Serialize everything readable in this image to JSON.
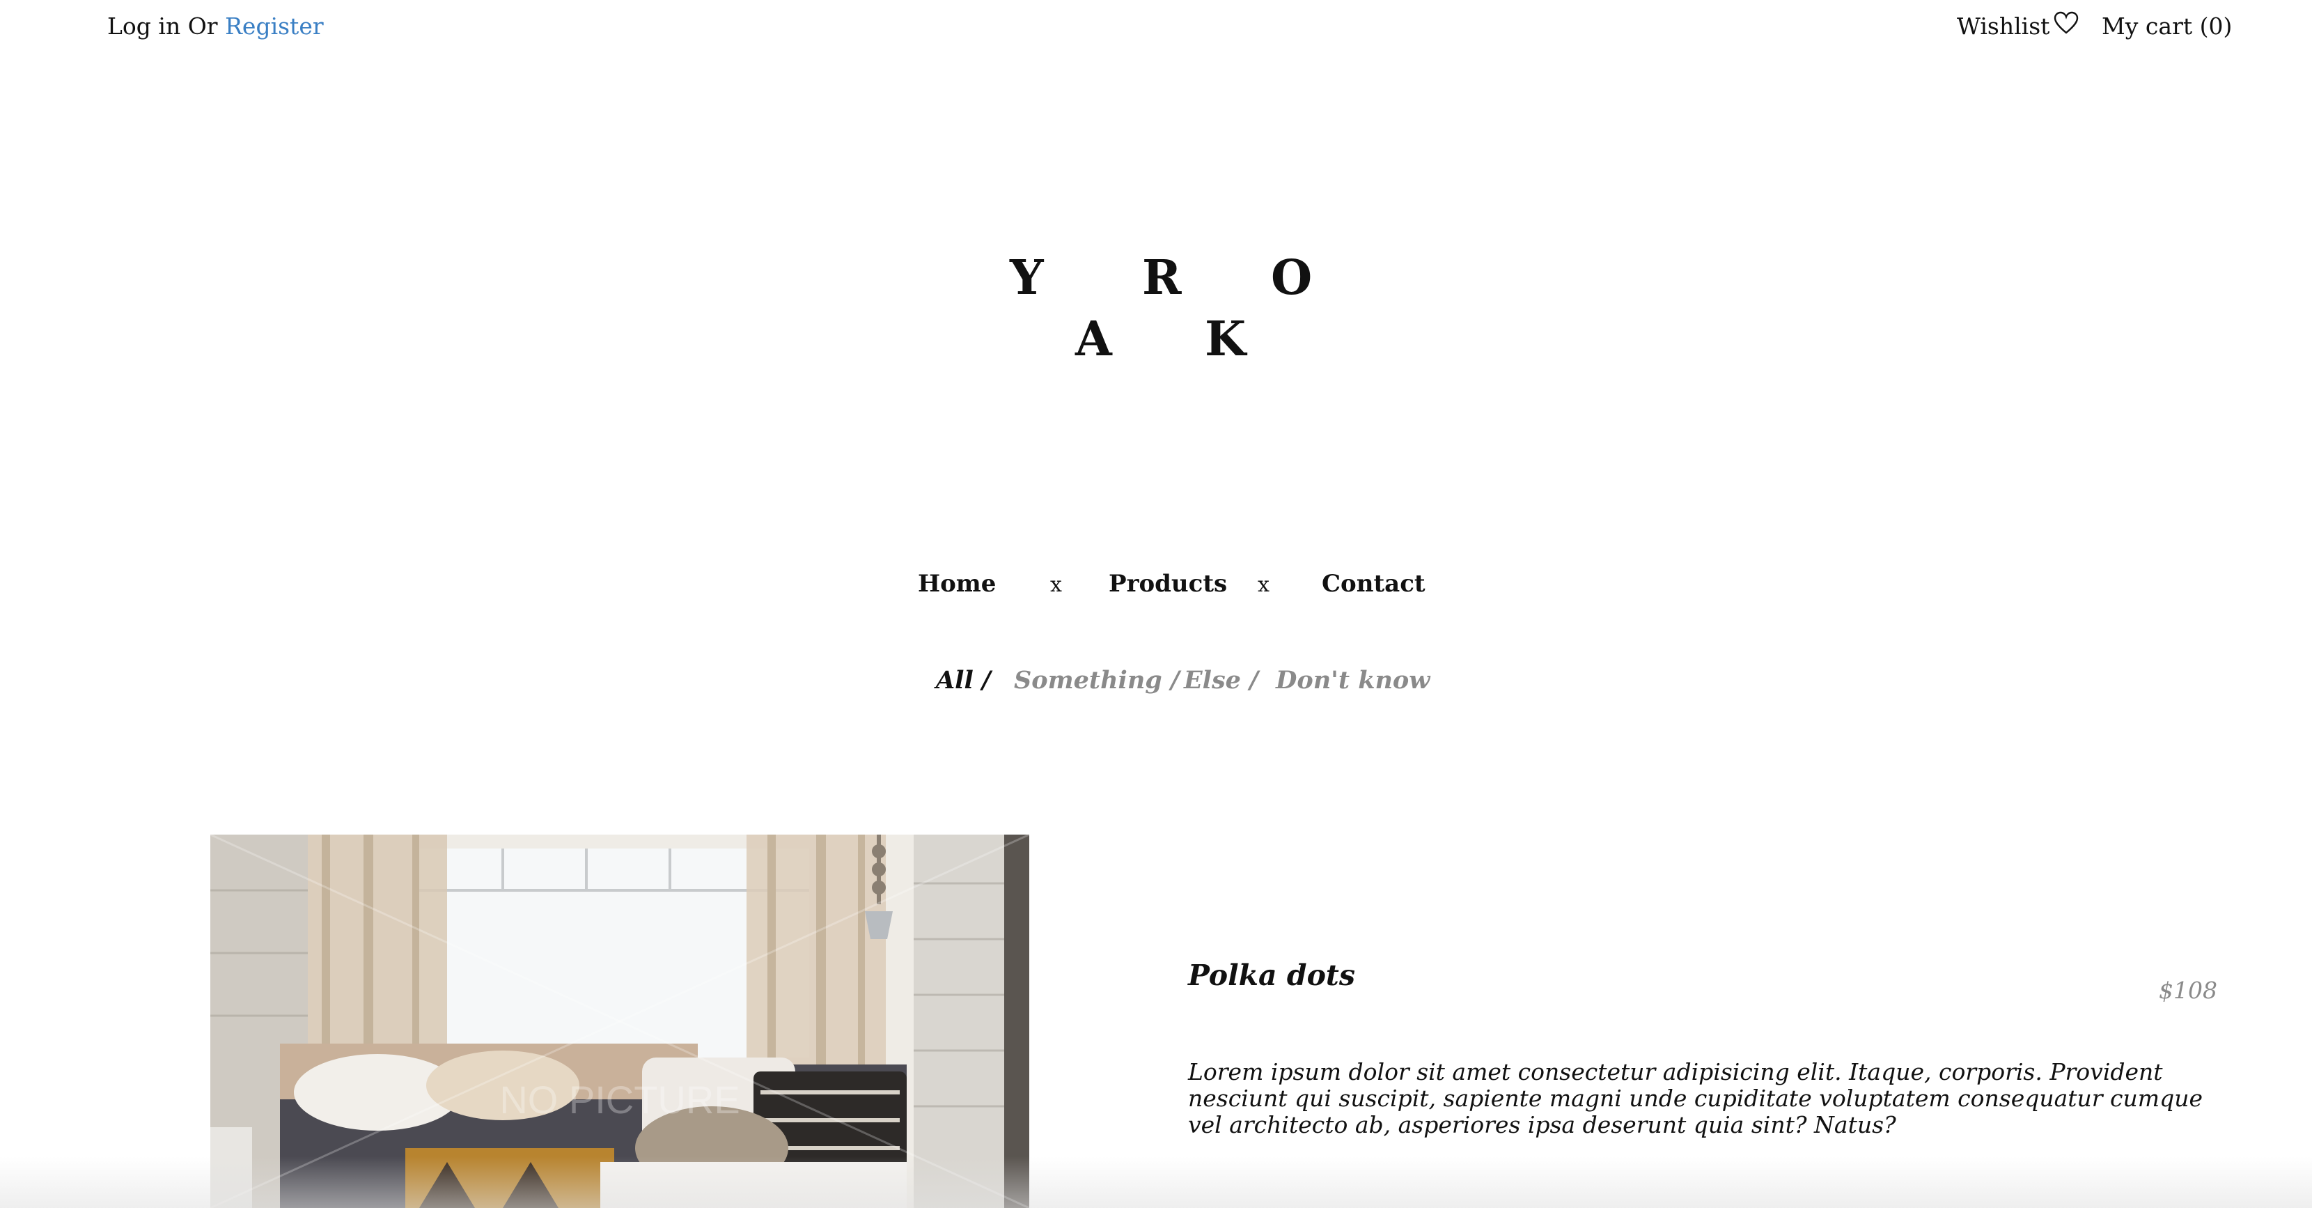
{
  "header": {
    "login_label": "Log in",
    "or_label": "Or",
    "register_label": "Register",
    "wishlist_label": "Wishlist",
    "cart_label": "My cart (0)"
  },
  "logo": {
    "letters": [
      "Y",
      "R",
      "O",
      "A",
      "K"
    ]
  },
  "main_nav": {
    "items": [
      "Home",
      "Products",
      "Contact"
    ],
    "separator": "x"
  },
  "filters": {
    "items": [
      "All /",
      "Something /",
      "Else /",
      "Don't know"
    ],
    "active": "All /"
  },
  "product": {
    "title": "Polka dots",
    "price": "$108",
    "description": "Lorem ipsum dolor sit amet consectetur adipisicing elit. Itaque, corporis. Provident nesciunt qui suscipit, sapiente magni unde cupiditate voluptatem consequatur cumque vel architecto ab, asperiores ipsa deserunt quia sint? Natus?",
    "image_watermark": "NO PICTURE"
  },
  "colors": {
    "link": "#3a7fc4",
    "muted": "#8a8a8a",
    "text": "#111111",
    "background": "#ffffff"
  },
  "icons": [
    "heart-outline-icon"
  ]
}
